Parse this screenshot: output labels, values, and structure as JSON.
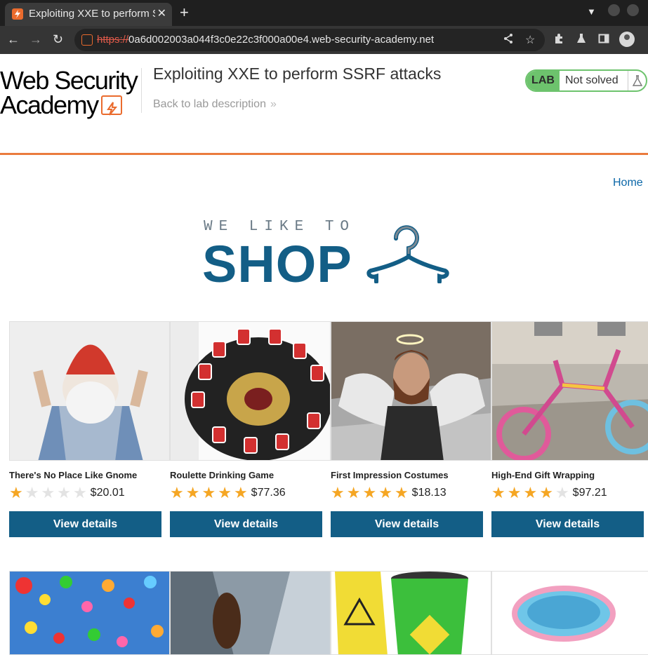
{
  "browser": {
    "tab_title": "Exploiting XXE to perform SSRF attacks",
    "url_scheme": "https://",
    "url_rest": "0a6d002003a044f3c0e22c3f000a00e4.web-security-academy.net"
  },
  "header": {
    "logo_line1": "Web Security",
    "logo_line2": "Academy",
    "title": "Exploiting XXE to perform SSRF attacks",
    "back_link": "Back to lab description",
    "badge_label": "LAB",
    "badge_status": "Not solved"
  },
  "nav": {
    "home": "Home"
  },
  "hero": {
    "small": "WE LIKE TO",
    "big": "SHOP"
  },
  "products": [
    {
      "name": "There's No Place Like Gnome",
      "rating": 1,
      "price": "$20.01",
      "button": "View details"
    },
    {
      "name": "Roulette Drinking Game",
      "rating": 5,
      "price": "$77.36",
      "button": "View details"
    },
    {
      "name": "First Impression Costumes",
      "rating": 5,
      "price": "$18.13",
      "button": "View details"
    },
    {
      "name": "High-End Gift Wrapping",
      "rating": 4,
      "price": "$97.21",
      "button": "View details"
    }
  ],
  "colors": {
    "accent": "#135e86",
    "brand": "#ea6b2d",
    "star": "#f5a623",
    "solved_green": "#6dc36d"
  }
}
